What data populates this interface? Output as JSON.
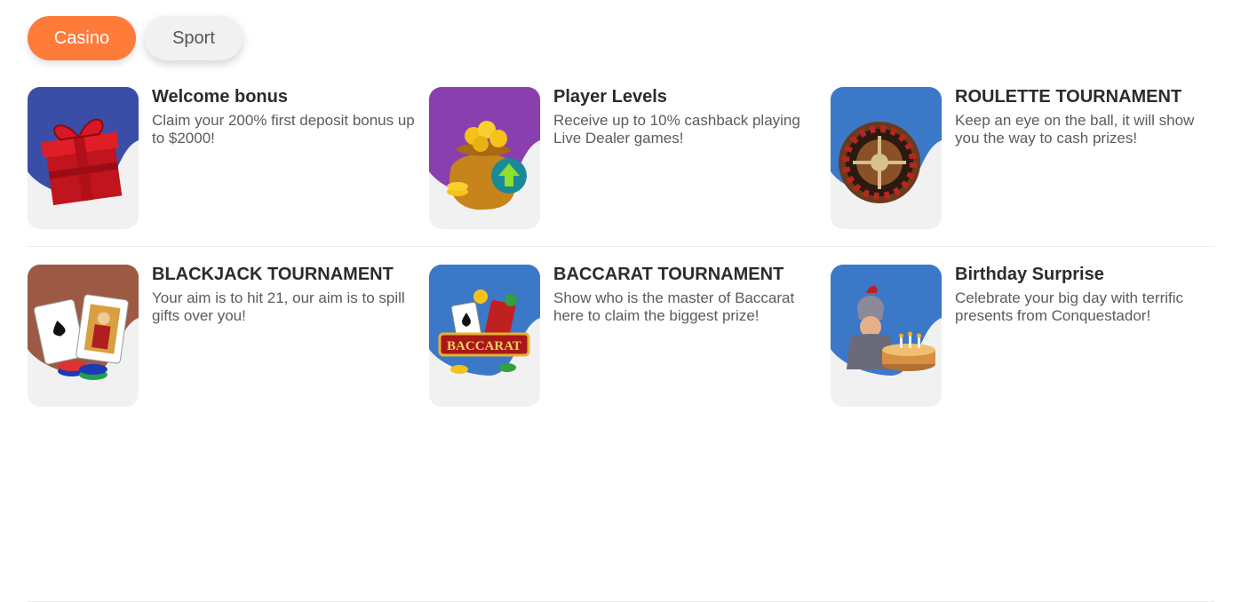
{
  "tabs": [
    {
      "label": "Casino",
      "active": true
    },
    {
      "label": "Sport",
      "active": false
    }
  ],
  "colors": {
    "accent": "#ff7b3a",
    "tab_inactive_bg": "#f1f1f1",
    "card_bg": "#f1f1f1",
    "blob_navy": "#3a4ea8",
    "blob_purple": "#8a3fae",
    "blob_blue": "#3c78c8",
    "blob_brown": "#9c5a44"
  },
  "promos": [
    {
      "title": "Welcome bonus",
      "description": "Claim your 200% first deposit bonus up to $2000!",
      "icon": "gift-box-icon"
    },
    {
      "title": "Player Levels",
      "description": "Receive up to 10% cashback playing Live Dealer games!",
      "icon": "gold-bag-icon"
    },
    {
      "title": "ROULETTE TOURNAMENT",
      "description": "Keep an eye on the ball, it will show you the way to cash prizes!",
      "icon": "roulette-wheel-icon"
    },
    {
      "title": "BLACKJACK TOURNAMENT",
      "description": "Your aim is to hit 21, our aim is to spill gifts over you!",
      "icon": "playing-cards-icon"
    },
    {
      "title": "BACCARAT TOURNAMENT",
      "description": "Show who is the master of Baccarat here to claim the biggest prize!",
      "icon": "baccarat-logo-icon",
      "logo_text": "BACCARAT"
    },
    {
      "title": "Birthday Surprise",
      "description": "Celebrate your big day with terrific presents from Conquestador!",
      "icon": "birthday-cake-icon"
    }
  ]
}
